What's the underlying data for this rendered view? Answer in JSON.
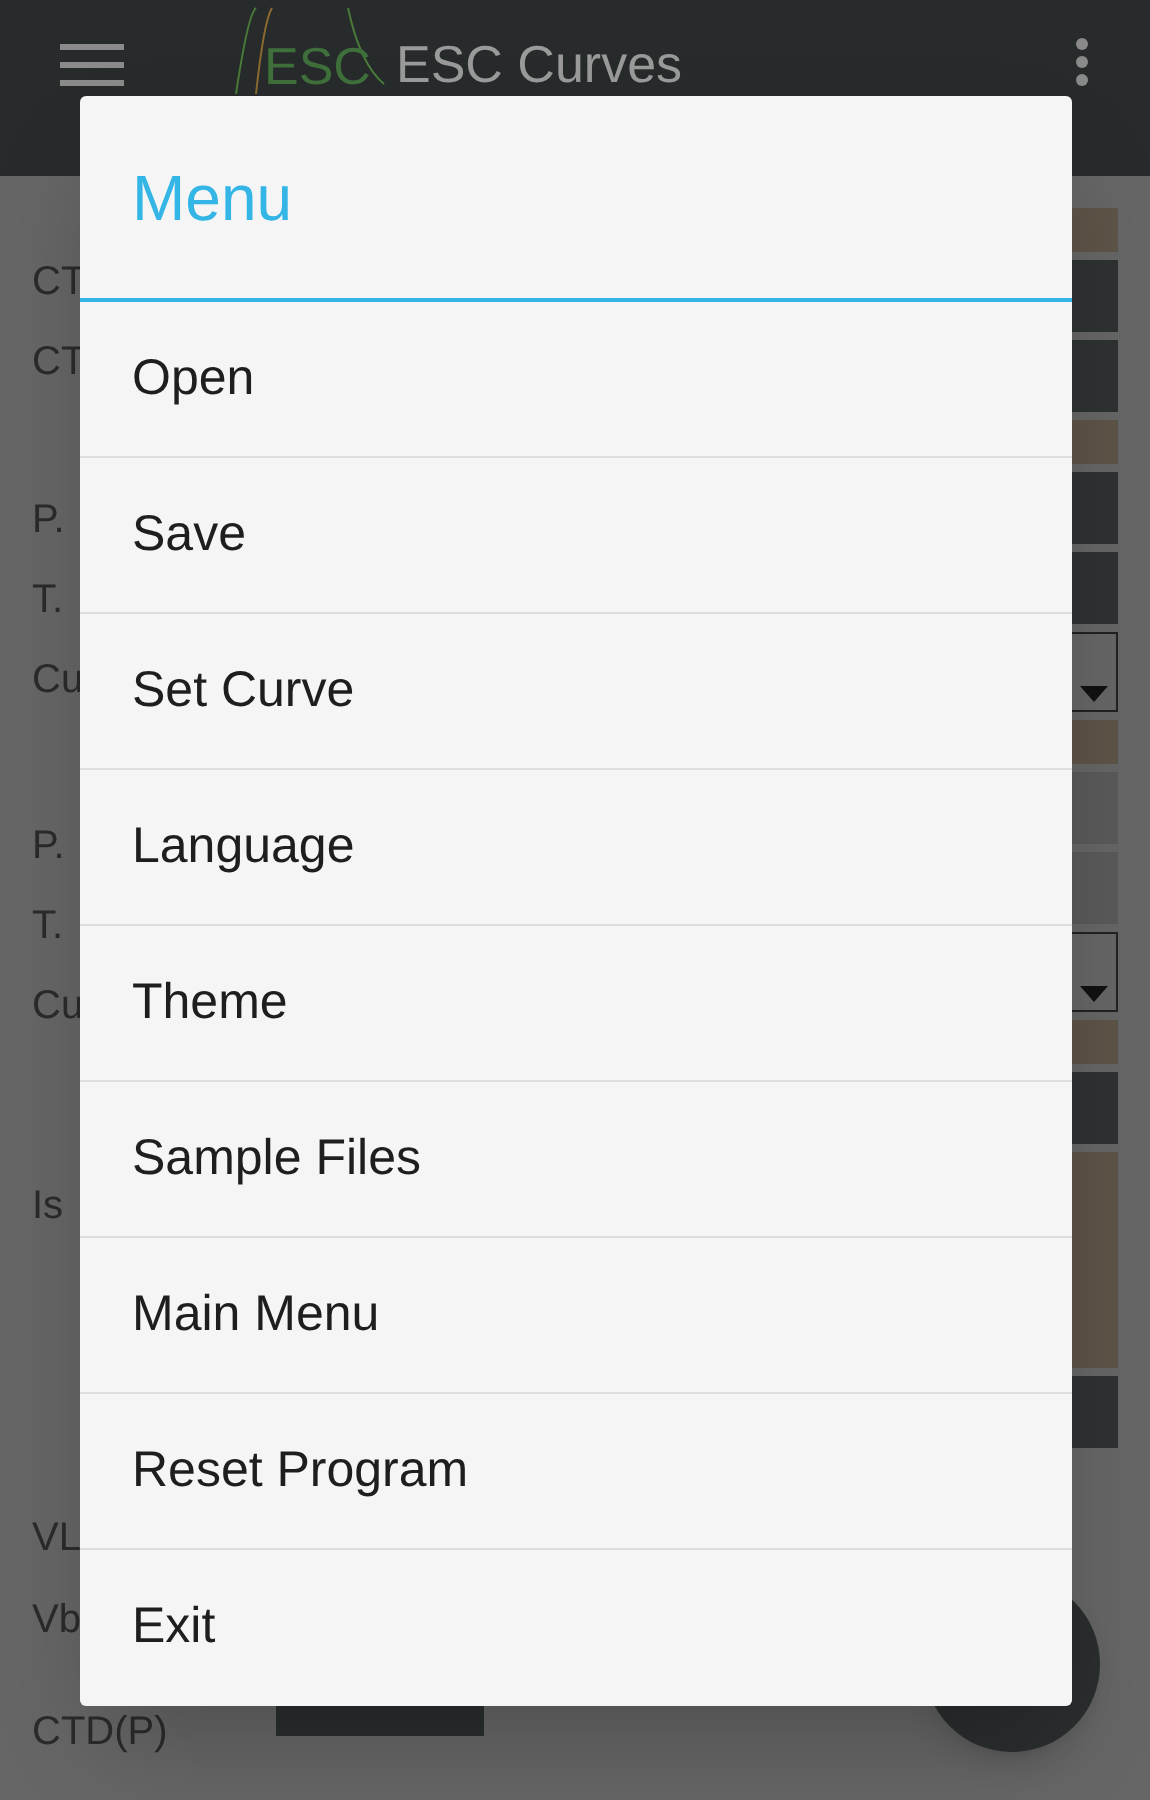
{
  "app_bar": {
    "logo_text": "ESC",
    "title": "ESC Curves"
  },
  "form_labels": [
    "CT",
    "CT",
    "P.",
    "T.",
    "Cu",
    "P.",
    "T.",
    "Cu",
    "Is",
    "VL",
    "Vb",
    "CTD(P)"
  ],
  "form_fields": [
    {
      "kind": "header"
    },
    {
      "kind": "dark"
    },
    {
      "kind": "dark"
    },
    {
      "kind": "header"
    },
    {
      "kind": "dark"
    },
    {
      "kind": "dark"
    },
    {
      "kind": "spinner"
    },
    {
      "kind": "header"
    },
    {
      "kind": "grey"
    },
    {
      "kind": "grey"
    },
    {
      "kind": "spinner"
    },
    {
      "kind": "header"
    },
    {
      "kind": "dark"
    },
    {
      "kind": "tall"
    },
    {
      "kind": "dark"
    }
  ],
  "menu_dialog": {
    "title": "Menu",
    "items": [
      "Open",
      "Save",
      "Set Curve",
      "Language",
      "Theme",
      "Sample Files",
      "Main Menu",
      "Reset Program",
      "Exit"
    ]
  }
}
